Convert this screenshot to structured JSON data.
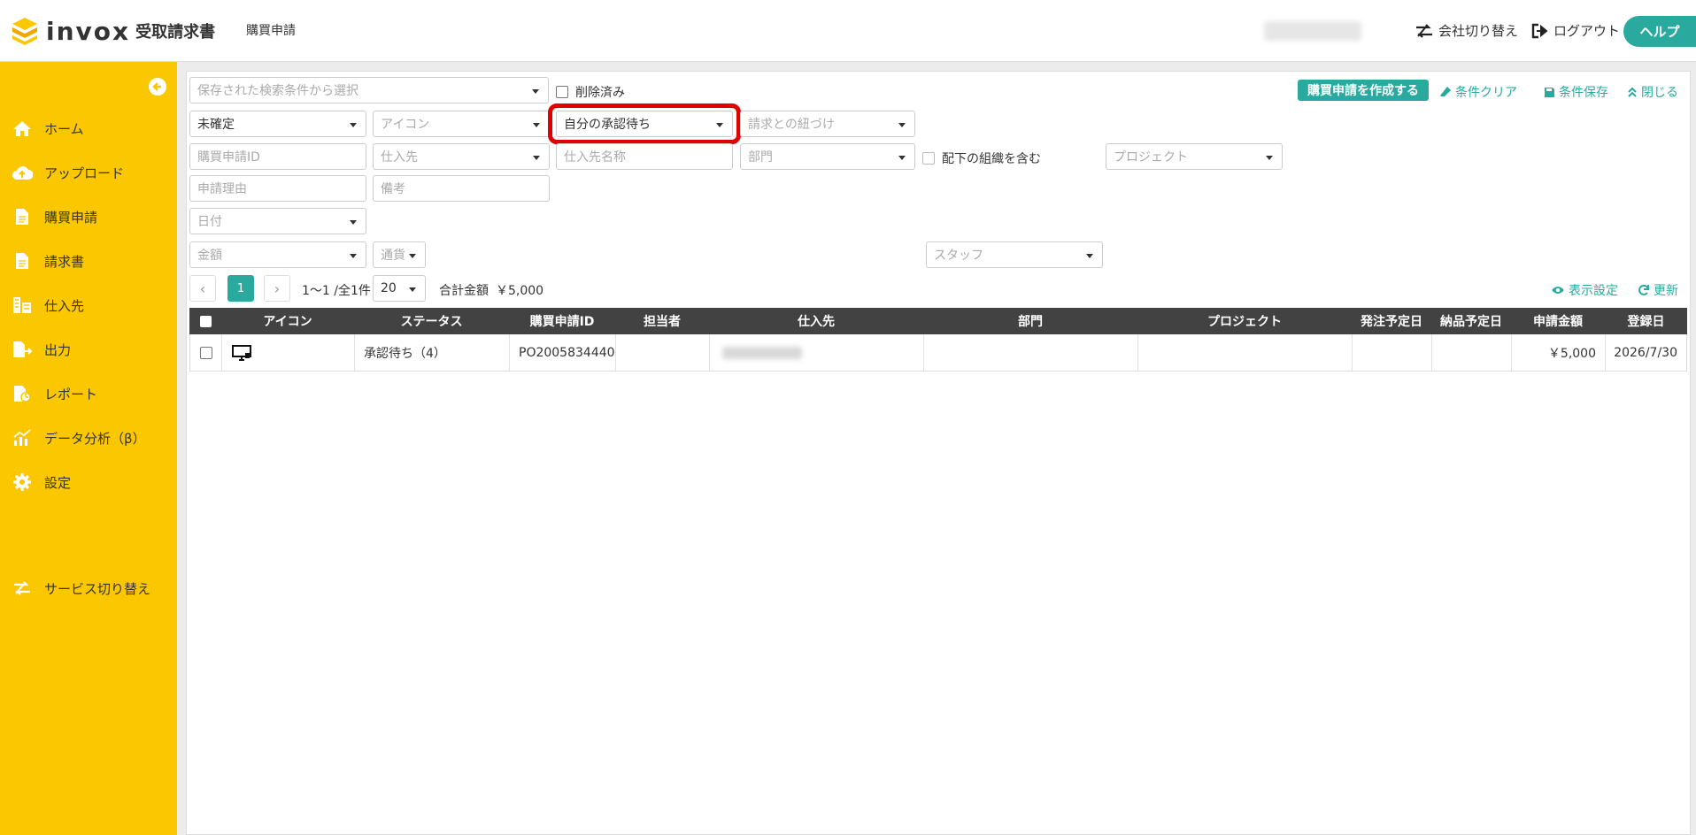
{
  "header": {
    "logo_text": "invox",
    "logo_sub": "受取請求書",
    "page_tab": "購買申請",
    "switch_company": "会社切り替え",
    "logout": "ログアウト",
    "help": "ヘルプ"
  },
  "sidebar": {
    "items": [
      {
        "label": "ホーム",
        "icon": "home-icon"
      },
      {
        "label": "アップロード",
        "icon": "cloud-upload-icon"
      },
      {
        "label": "購買申請",
        "icon": "document-icon"
      },
      {
        "label": "請求書",
        "icon": "document-icon"
      },
      {
        "label": "仕入先",
        "icon": "building-icon"
      },
      {
        "label": "出力",
        "icon": "export-icon"
      },
      {
        "label": "レポート",
        "icon": "report-icon"
      },
      {
        "label": "データ分析（β）",
        "icon": "chart-icon"
      },
      {
        "label": "設定",
        "icon": "gear-icon"
      },
      {
        "label": "サービス切り替え",
        "icon": "switch-icon"
      }
    ]
  },
  "filters": {
    "saved_search_placeholder": "保存された検索条件から選択",
    "deleted_label": "削除済み",
    "status_value": "未確定",
    "icon_placeholder": "アイコン",
    "approval_value": "自分の承認待ち",
    "invoice_link_placeholder": "請求との紐づけ",
    "request_id_placeholder": "購買申請ID",
    "supplier_placeholder": "仕入先",
    "supplier_name_placeholder": "仕入先名称",
    "department_placeholder": "部門",
    "include_sub_org_label": "配下の組織を含む",
    "project_placeholder": "プロジェクト",
    "reason_placeholder": "申請理由",
    "note_placeholder": "備考",
    "date_placeholder": "日付",
    "amount_placeholder": "金額",
    "currency_placeholder": "通貨",
    "staff_placeholder": "スタッフ"
  },
  "toolbar": {
    "create": "購買申請を作成する",
    "clear": "条件クリア",
    "save": "条件保存",
    "close": "閉じる",
    "display_settings": "表示設定",
    "refresh": "更新"
  },
  "pagination": {
    "current_page": "1",
    "range": "1〜1 /全1件",
    "per_page": "20",
    "total_label": "合計金額",
    "total_value": "￥5,000",
    "prev": "‹",
    "next": "›"
  },
  "table": {
    "headers": [
      "アイコン",
      "ステータス",
      "購買申請ID",
      "担当者",
      "仕入先",
      "部門",
      "プロジェクト",
      "発注予定日",
      "納品予定日",
      "申請金額",
      "登録日"
    ],
    "rows": [
      {
        "status": "承認待ち（4）",
        "request_id": "PO2005834440",
        "amount": "￥5,000",
        "registered": "2026/7/30"
      }
    ]
  },
  "colors": {
    "accent": "#2aaa9f",
    "sidebar": "#fac700",
    "header_row": "#424242",
    "highlight": "#e00000"
  }
}
